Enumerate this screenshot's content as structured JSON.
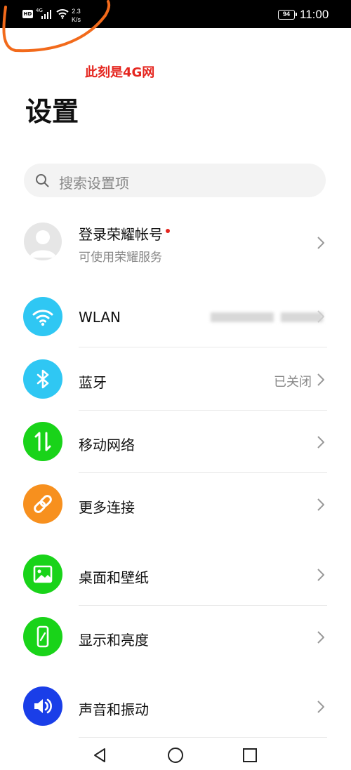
{
  "status_bar": {
    "hd": "HD",
    "network_type": "4G",
    "speed_value": "2.3",
    "speed_unit": "K/s",
    "battery": "94",
    "time": "11:00"
  },
  "annotation": {
    "text": "此刻是4G网",
    "color": "#e5261f"
  },
  "page_title": "设置",
  "search": {
    "placeholder": "搜索设置项"
  },
  "account": {
    "title": "登录荣耀帐号",
    "subtitle": "可使用荣耀服务"
  },
  "settings": [
    {
      "label": "WLAN",
      "value": "",
      "icon": "wifi-icon",
      "color": "#2fc7f3"
    },
    {
      "label": "蓝牙",
      "value": "已关闭",
      "icon": "bluetooth-icon",
      "color": "#2fc7f3"
    },
    {
      "label": "移动网络",
      "value": "",
      "icon": "mobile-data-icon",
      "color": "#19d319"
    },
    {
      "label": "更多连接",
      "value": "",
      "icon": "link-icon",
      "color": "#f7901e"
    },
    {
      "label": "桌面和壁纸",
      "value": "",
      "icon": "wallpaper-icon",
      "color": "#19d319"
    },
    {
      "label": "显示和亮度",
      "value": "",
      "icon": "display-icon",
      "color": "#19d319"
    },
    {
      "label": "声音和振动",
      "value": "",
      "icon": "sound-icon",
      "color": "#1a3ee8"
    }
  ],
  "nav": {
    "back": "back-icon",
    "home": "home-icon",
    "recents": "recents-icon"
  }
}
